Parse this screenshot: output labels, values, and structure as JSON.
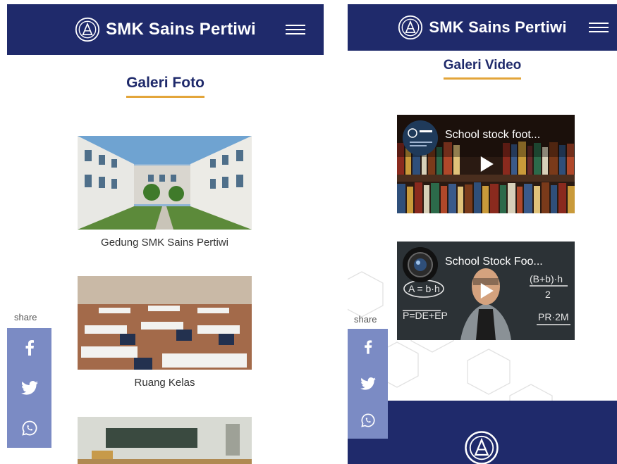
{
  "left": {
    "header": {
      "title": "SMK Sains Pertiwi"
    },
    "section_title": "Galeri Foto",
    "photos": [
      {
        "caption": "Gedung SMK Sains Pertiwi"
      },
      {
        "caption": "Ruang Kelas"
      },
      {
        "caption": ""
      }
    ],
    "share": {
      "label": "share",
      "icons": [
        "facebook-icon",
        "twitter-icon",
        "whatsapp-icon"
      ]
    }
  },
  "right": {
    "header": {
      "title": "SMK Sains Pertiwi"
    },
    "section_title": "Galeri Video",
    "videos": [
      {
        "title": "School stock foot..."
      },
      {
        "title": "School Stock Foo..."
      }
    ],
    "share": {
      "label": "share",
      "icons": [
        "facebook-icon",
        "twitter-icon",
        "whatsapp-icon"
      ]
    }
  },
  "colors": {
    "navy": "#1f2a6b",
    "accent": "#e3a53a",
    "share_bar": "#7b8bc4"
  }
}
